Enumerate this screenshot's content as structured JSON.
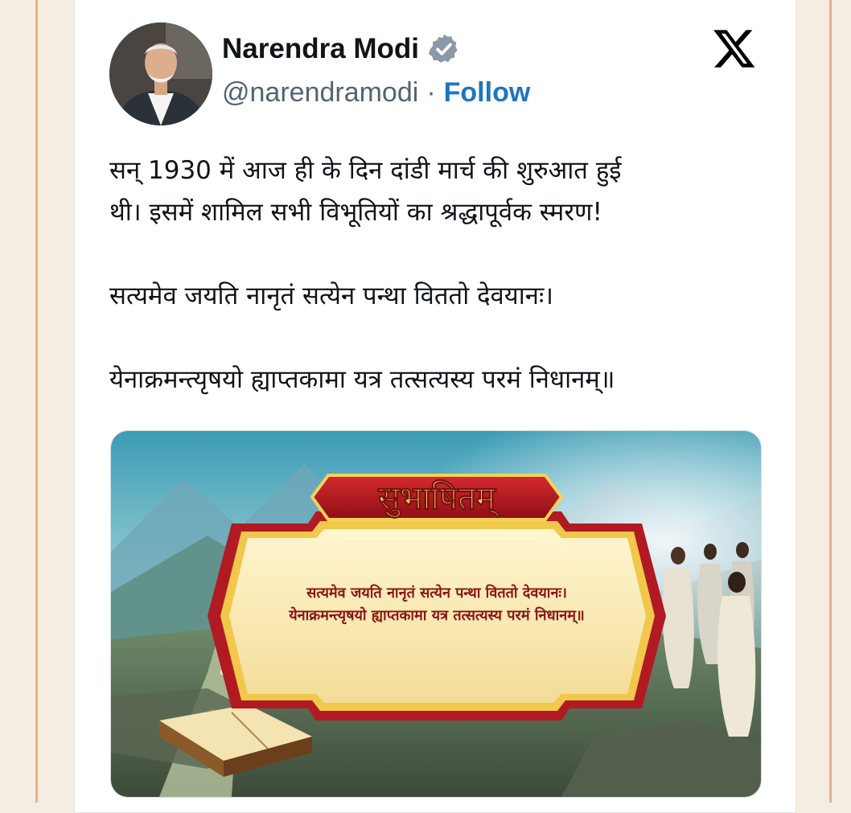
{
  "author": {
    "name": "Narendra Modi",
    "handle": "@narendramodi",
    "separator": "·",
    "follow_label": "Follow",
    "verified_icon": "verified-badge-icon"
  },
  "platform_logo": "x-logo-icon",
  "tweet": {
    "lines": [
      "सन् 1930 में आज ही के दिन दांडी मार्च की शुरुआत हुई",
      "थी। इसमें शामिल सभी विभूतियों का श्रद्धापूर्वक स्मरण!",
      "सत्यमेव जयति नानृतं सत्येन पन्था विततो देवयानः।",
      "येनाक्रमन्त्यृषयो ह्याप्तकामा यत्र तत्सत्यस्य परमं निधानम्॥"
    ]
  },
  "media": {
    "banner_title": "सुभाषितम्",
    "verse_line_1": "सत्यमेव जयति नानृतं सत्येन पन्था विततो देवयानः।",
    "verse_line_2": "येनाक्रमन्त्यृषयो ह्याप्तकामा यत्र तत्सत्यस्य परमं निधानम्॥"
  },
  "colors": {
    "follow": "#1d76c2",
    "banner_red": "#b11a22",
    "banner_gold": "#f3d25a",
    "scroll_paper": "#fbf0c4",
    "verse_text": "#8b1414"
  }
}
